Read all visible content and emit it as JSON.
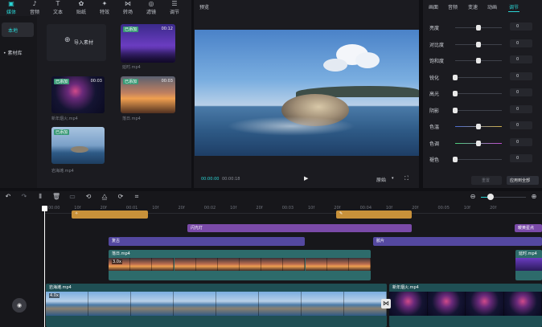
{
  "toolbar": {
    "items": [
      {
        "label": "媒体",
        "icon": "media-icon"
      },
      {
        "label": "音频",
        "icon": "audio-icon"
      },
      {
        "label": "文本",
        "icon": "text-icon"
      },
      {
        "label": "贴纸",
        "icon": "sticker-icon"
      },
      {
        "label": "特效",
        "icon": "effects-icon"
      },
      {
        "label": "转场",
        "icon": "transition-icon"
      },
      {
        "label": "滤镜",
        "icon": "filter-icon"
      },
      {
        "label": "调节",
        "icon": "adjust-icon"
      }
    ]
  },
  "sidebar": {
    "local": "本地",
    "library": "• 素材库"
  },
  "media": {
    "import_label": "导入素材",
    "items": [
      {
        "badge": "已添加",
        "duration": "00:12",
        "name": "延时.mp4"
      },
      {
        "badge": "已添加",
        "duration": "00:03",
        "name": "新年烟火.mp4"
      },
      {
        "badge": "已添加",
        "duration": "00:03",
        "name": "落日.mp4"
      },
      {
        "badge": "已添加",
        "duration": "",
        "name": "岩海滩.mp4"
      }
    ]
  },
  "preview": {
    "title": "预览",
    "time_current": "00:00:00",
    "time_total": "00:00:18",
    "ratio": "原始"
  },
  "right_panel": {
    "tabs": [
      "画面",
      "音频",
      "变速",
      "动画",
      "调节"
    ],
    "active_tab": "调节",
    "rows": [
      {
        "label": "亮度",
        "value": "0",
        "knob": 0.5
      },
      {
        "label": "对比度",
        "value": "0",
        "knob": 0.5
      },
      {
        "label": "饱和度",
        "value": "0",
        "knob": 0.5
      },
      {
        "label": "锐化",
        "value": "0",
        "knob": 0.0
      },
      {
        "label": "高光",
        "value": "0",
        "knob": 0.0
      },
      {
        "label": "阴影",
        "value": "0",
        "knob": 0.0
      },
      {
        "label": "色温",
        "value": "0",
        "knob": 0.5
      },
      {
        "label": "色调",
        "value": "0",
        "knob": 0.5
      },
      {
        "label": "褪色",
        "value": "0",
        "knob": 0.0
      }
    ],
    "reset": "重置",
    "apply_all": "应用到全部"
  },
  "timeline": {
    "ruler": [
      "00:00",
      "10f",
      "20f",
      "00:01",
      "10f",
      "20f",
      "00:02",
      "10f",
      "20f",
      "00:03",
      "10f",
      "20f",
      "00:04",
      "10f",
      "20f",
      "00:05",
      "10f",
      "20f"
    ],
    "clips": {
      "effect_1": "闪光灯",
      "filter_1": "复古",
      "filter_2": "胶片",
      "filter_3": "暖黄星点",
      "video_top_1": "落日.mp4",
      "video_top_1_speed": "3.0x",
      "video_top_2": "延时.mp4",
      "main_1": "岩海滩.mp4",
      "main_1_speed": "4.0x",
      "main_2": "新年烟火.mp4"
    },
    "colors": {
      "sticker": "#c8913a",
      "effect": "#7a4aa8",
      "filter": "#5448a0",
      "video": "#2d6b6b"
    }
  }
}
